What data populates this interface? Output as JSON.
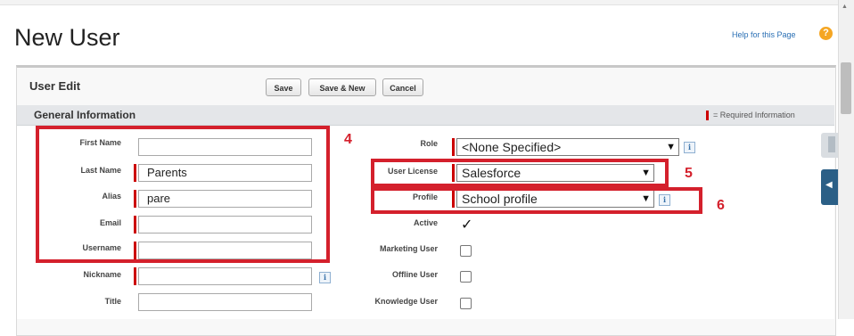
{
  "header": {
    "title": "New User",
    "help_link": "Help for this Page",
    "help_icon": "?"
  },
  "panel": {
    "title": "User Edit"
  },
  "toolbar": {
    "save_label": "Save",
    "save_new_label": "Save & New",
    "cancel_label": "Cancel"
  },
  "section": {
    "title": "General Information",
    "required_note": "= Required Information"
  },
  "left_fields": {
    "first_name": {
      "label": "First Name",
      "value": ""
    },
    "last_name": {
      "label": "Last Name",
      "value": "Parents"
    },
    "alias": {
      "label": "Alias",
      "value": "pare"
    },
    "email": {
      "label": "Email",
      "value": ""
    },
    "username": {
      "label": "Username",
      "value": ""
    },
    "nickname": {
      "label": "Nickname",
      "value": ""
    },
    "title": {
      "label": "Title",
      "value": ""
    }
  },
  "right_fields": {
    "role": {
      "label": "Role",
      "value": "<None Specified>"
    },
    "user_license": {
      "label": "User License",
      "value": "Salesforce"
    },
    "profile": {
      "label": "Profile",
      "value": "School profile"
    },
    "active": {
      "label": "Active",
      "checked": true,
      "mark": "✓"
    },
    "marketing_user": {
      "label": "Marketing User",
      "checked": false
    },
    "offline_user": {
      "label": "Offline User",
      "checked": false
    },
    "knowledge_user": {
      "label": "Knowledge User",
      "checked": false
    }
  },
  "annotations": {
    "n4": "4",
    "n5": "5",
    "n6": "6"
  },
  "info_glyph": "i",
  "colors": {
    "annotation": "#d4202c",
    "required": "#cc0000",
    "link": "#2a6fb4",
    "side_tab": "#2b5f86"
  }
}
